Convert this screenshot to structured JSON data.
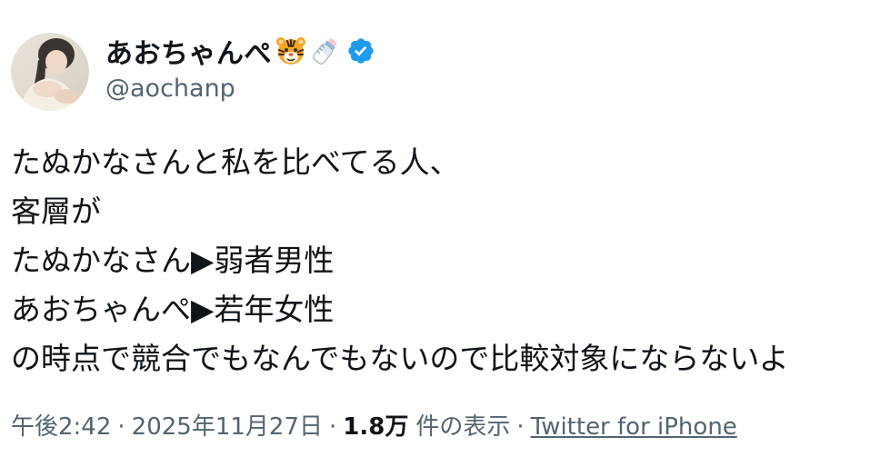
{
  "user": {
    "display_name": "あおちゃんぺ",
    "handle": "@aochanp",
    "name_emojis": [
      "tiger-face-icon",
      "baby-bottle-icon"
    ],
    "verified": true
  },
  "tweet": {
    "lines": [
      "たぬかなさんと私を比べてる人、",
      "客層が",
      "たぬかなさん▶︎弱者男性",
      "あおちゃんぺ▶︎若年女性",
      "の時点で競合でもなんでもないので比較対象にならないよ"
    ]
  },
  "meta": {
    "time": "午後2:42",
    "separator": "·",
    "date": "2025年11月27日",
    "views_count": "1.8万",
    "views_label": "件の表示",
    "source": "Twitter for iPhone"
  },
  "colors": {
    "text": "#0f1419",
    "secondary": "#536471",
    "verified": "#1d9bf0"
  }
}
